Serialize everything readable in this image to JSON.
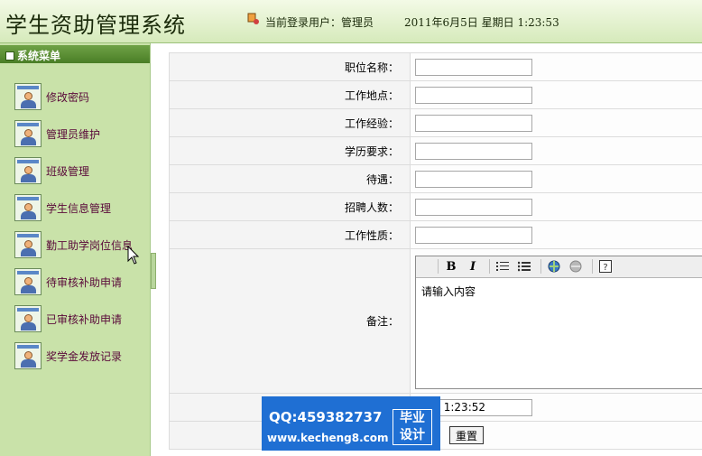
{
  "header": {
    "title": "学生资助管理系统",
    "login_label": "当前登录用户：",
    "login_user": "管理员",
    "datetime": "2011年6月5日  星期日  1:23:53"
  },
  "sidebar": {
    "heading": "系统菜单",
    "items": [
      {
        "label": "修改密码"
      },
      {
        "label": "管理员维护"
      },
      {
        "label": "班级管理"
      },
      {
        "label": "学生信息管理"
      },
      {
        "label": "勤工助学岗位信息"
      },
      {
        "label": "待审核补助申请"
      },
      {
        "label": "已审核补助申请"
      },
      {
        "label": "奖学金发放记录"
      }
    ]
  },
  "form": {
    "fields": [
      {
        "label": "职位名称：",
        "value": ""
      },
      {
        "label": "工作地点：",
        "value": ""
      },
      {
        "label": "工作经验：",
        "value": ""
      },
      {
        "label": "学历要求：",
        "value": ""
      },
      {
        "label": "待遇：",
        "value": ""
      },
      {
        "label": "招聘人数：",
        "value": ""
      },
      {
        "label": "工作性质：",
        "value": ""
      }
    ],
    "remark_label": "备注：",
    "editor_text": "请输入内容",
    "date_value": "-6-5 1:23:52",
    "reset_label": "重置",
    "toolbar_icons": [
      "bold-icon",
      "italic-icon",
      "ordered-list-icon",
      "unordered-list-icon",
      "link-icon",
      "unlink-icon",
      "help-icon"
    ]
  },
  "watermark": {
    "qq": "QQ:459382737",
    "url": "www.kecheng8.com",
    "badge_line1": "毕业",
    "badge_line2": "设计"
  },
  "colors": {
    "header_bg": "#d6eabb",
    "sidebar_bg": "#c9e2a9",
    "menu_head_bg": "#4a7e26",
    "menu_text": "#5a0a3a",
    "watermark_bg": "#1f6fd3"
  }
}
